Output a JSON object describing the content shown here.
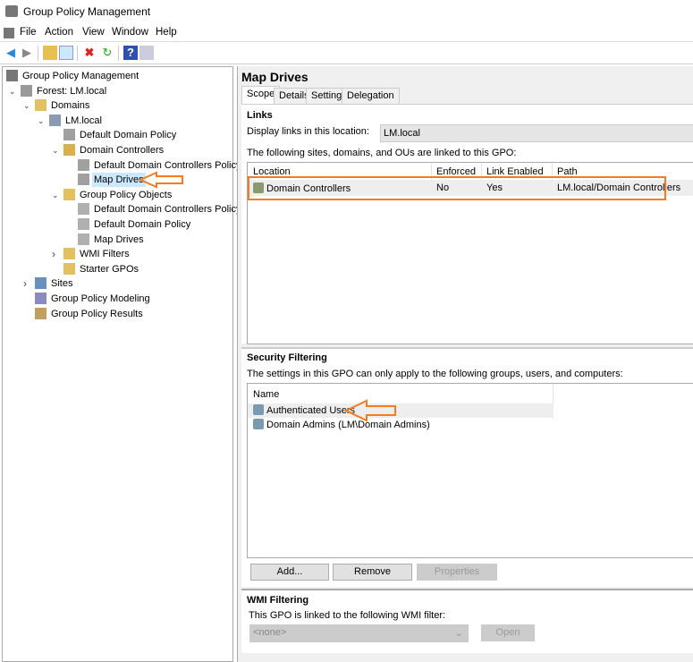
{
  "window": {
    "title": "Group Policy Management"
  },
  "menu": [
    "File",
    "Action",
    "View",
    "Window",
    "Help"
  ],
  "tree": [
    {
      "label": "Group Policy Management",
      "level": 0,
      "icon": "gpm-icon"
    },
    {
      "label": "Forest: LM.local",
      "level": 1,
      "icon": "forest-icon",
      "expanded": true
    },
    {
      "label": "Domains",
      "level": 2,
      "icon": "folder-icon",
      "expanded": true
    },
    {
      "label": "LM.local",
      "level": 3,
      "icon": "domain-icon",
      "expanded": true
    },
    {
      "label": "Default Domain Policy",
      "level": 4,
      "icon": "gpo-link-icon"
    },
    {
      "label": "Domain Controllers",
      "level": 4,
      "icon": "ou-icon",
      "expanded": true
    },
    {
      "label": "Default Domain Controllers Policy",
      "level": 5,
      "icon": "gpo-link-icon"
    },
    {
      "label": "Map Drives",
      "level": 5,
      "icon": "gpo-link-icon",
      "selected": true
    },
    {
      "label": "Group Policy Objects",
      "level": 4,
      "icon": "folder-icon",
      "expanded": true
    },
    {
      "label": "Default Domain Controllers Policy",
      "level": 5,
      "icon": "gpo-icon"
    },
    {
      "label": "Default Domain Policy",
      "level": 5,
      "icon": "gpo-icon"
    },
    {
      "label": "Map Drives",
      "level": 5,
      "icon": "gpo-icon"
    },
    {
      "label": "WMI Filters",
      "level": 4,
      "icon": "folder-icon",
      "expanded": false
    },
    {
      "label": "Starter GPOs",
      "level": 4,
      "icon": "folder-icon"
    },
    {
      "label": "Sites",
      "level": 2,
      "icon": "sites-icon",
      "expanded": false
    },
    {
      "label": "Group Policy Modeling",
      "level": 2,
      "icon": "modeling-icon"
    },
    {
      "label": "Group Policy Results",
      "level": 2,
      "icon": "results-icon"
    }
  ],
  "detail": {
    "title": "Map Drives",
    "tabs": [
      "Scope",
      "Details",
      "Settings",
      "Delegation"
    ],
    "links": {
      "heading": "Links",
      "location_label": "Display links in this location:",
      "location_value": "LM.local",
      "desc": "The following sites, domains, and OUs are linked to this GPO:",
      "columns": [
        "Location",
        "Enforced",
        "Link Enabled",
        "Path"
      ],
      "rows": [
        [
          "Domain Controllers",
          "No",
          "Yes",
          "LM.local/Domain Controllers"
        ]
      ]
    },
    "security": {
      "heading": "Security Filtering",
      "desc": "The settings in this GPO can only apply to the following groups, users, and computers:",
      "column": "Name",
      "rows": [
        "Authenticated Users",
        "Domain Admins (LM\\Domain Admins)"
      ],
      "buttons": {
        "add": "Add...",
        "remove": "Remove",
        "properties": "Properties"
      }
    },
    "wmi": {
      "heading": "WMI Filtering",
      "desc": "This GPO is linked to the following WMI filter:",
      "value": "<none>",
      "open": "Open"
    }
  },
  "colors": {
    "highlight": "#f47b20",
    "selection": "#cce8ff"
  }
}
